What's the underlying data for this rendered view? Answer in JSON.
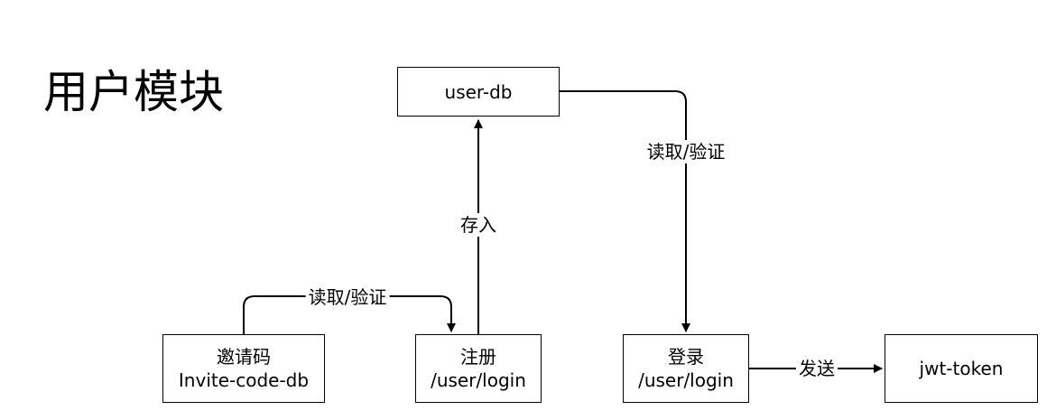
{
  "title": "用户模块",
  "nodes": {
    "user_db": {
      "lines": [
        "user-db"
      ]
    },
    "invite_db": {
      "lines": [
        "邀请码",
        "Invite-code-db"
      ]
    },
    "register": {
      "lines": [
        "注册",
        "/user/login"
      ]
    },
    "login": {
      "lines": [
        "登录",
        "/user/login"
      ]
    },
    "jwt": {
      "lines": [
        "jwt-token"
      ]
    }
  },
  "edges": {
    "invite_to_register": {
      "label": "读取/验证"
    },
    "register_to_db": {
      "label": "存入"
    },
    "db_to_login": {
      "label": "读取/验证"
    },
    "login_to_jwt": {
      "label": "发送"
    }
  },
  "colors": {
    "stroke": "#000000",
    "background": "#ffffff"
  }
}
